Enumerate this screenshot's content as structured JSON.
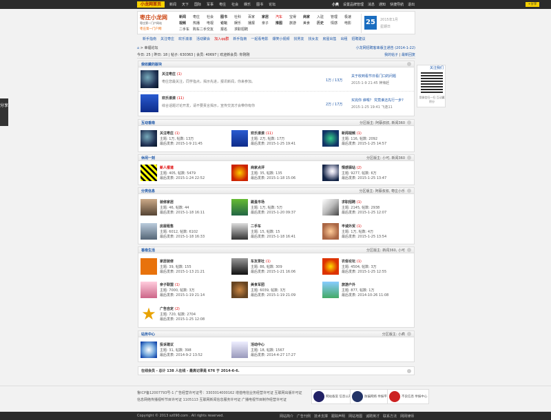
{
  "topbar": {
    "logo": "小龙网首页",
    "nav": [
      "新闻",
      "天下",
      "国际",
      "军事",
      "枣庄",
      "社会",
      "娱乐",
      "图书",
      "论坛"
    ],
    "user": "小奥",
    "links": [
      "设置品牌管理",
      "消息",
      "通知",
      "快捷导航",
      "退出"
    ],
    "share": "+分享"
  },
  "brand": {
    "line1": "枣庄小龙网",
    "line2": "枣庄第一门户网站",
    "line3": "枣庄第一门户网"
  },
  "categories": [
    [
      "新闻",
      "枣庄",
      "社会",
      "图书",
      "社科",
      "百家",
      "家居",
      "汽车",
      "宝得",
      "商家",
      "入驻",
      "管理",
      "极速",
      "二手车",
      "购车二手"
    ],
    [
      "视频",
      "热播",
      "电视",
      "论坛",
      "娱乐",
      "播报",
      "亲子",
      "推图",
      "旅游",
      "美食",
      "历史",
      "情感",
      "电影",
      "交友",
      "报名",
      "求职招聘"
    ]
  ],
  "date": {
    "day": "25",
    "ym": "2015年1月",
    "week": "星期日"
  },
  "subnav": [
    "新手指南",
    "关注枣庄",
    "欢乐滚滚",
    "活动聚会",
    "加入qq群",
    "新手指南",
    "一起看电影",
    "爆笑小视频",
    "找男友",
    "找女友",
    "房屋出售",
    "出租",
    "招聘建议"
  ],
  "crumb": {
    "left": "> 幸福论坛",
    "right": "小龙网招聘客串版主通告 (2014-1-22)"
  },
  "stats": {
    "left": "今日: 25 | 昨日: 18 | 帖子: 630363 | 会员: 40697 | 欢迎新会员: 你刚刚",
    "right_a": "我的帖子",
    "right_b": "最新回复"
  },
  "sections": {
    "favorites": {
      "title": "我收藏的版块",
      "rows": [
        {
          "name": "关注枣庄",
          "count": "(1)",
          "desc": "枣庄您最关注，同学指点，揭示先进，报讯新闻，你来参加。",
          "ratio": "1万 / 13万",
          "last": "关于收到看节日看门口的问题",
          "last_meta": "2015-1-9 21:45 神辣赶"
        },
        {
          "name": "欢乐滚滚",
          "count": "(11)",
          "desc": "综合话题讨论开发，请不要贡言揭示，宣传交流才会带你有你",
          "ratio": "2万 / 17万",
          "last": "买完你 谁喂？ 究竟谁还先行一步?",
          "last_meta": "2015-1-25 19:41 飞逸11"
        }
      ]
    },
    "interact": {
      "title": "互动香南",
      "mods": "分区版主: 阿蔡叔叔, 新闻360"
    },
    "share": {
      "title": "休闲一刻",
      "mods": "分区版主: 小可, 新闻360"
    },
    "info": {
      "title": "分类信息",
      "mods": "分区版主: 阿蔡叔叔, 枣庄小乐"
    },
    "life": {
      "title": "香南生活",
      "mods": "分区版主: 新闻360, 小可"
    },
    "station": {
      "title": "站务中心",
      "mods": "分区版主: 小疯"
    }
  },
  "cells": {
    "interact": [
      {
        "name": "关注枣庄",
        "count": "(1)",
        "l2": "主题: 1万, 帖数: 13万",
        "l3": "最后发表: 2015-1-9 21:45"
      },
      {
        "name": "欢乐滚滚",
        "count": "(11)",
        "l2": "主题: 2万, 帖数: 17万",
        "l3": "最后发表: 2015-1-25 19:41"
      },
      {
        "name": "新闻视频",
        "count": "(1)",
        "l2": "主题: 116, 帖数: 2092",
        "l3": "最后发表: 2015-1-25 14:57"
      }
    ],
    "share": [
      {
        "name": "新人报道",
        "count": "",
        "l2": "主题: 405, 帖数: 5479",
        "l3": "最后发表: 2015-1-24 22:52"
      },
      {
        "name": "商家点评",
        "count": "",
        "l2": "主题: 35, 帖数: 135",
        "l3": "最后发表: 2015-1-18 15:06"
      },
      {
        "name": "情感驿站",
        "count": "(2)",
        "l2": "主题: 9277, 帖数: 6万",
        "l3": "最后发表: 2015-1-25 13:47"
      }
    ],
    "info": [
      {
        "name": "装修家居",
        "count": "",
        "l2": "主题: 46, 帖数: 44",
        "l3": "最后发表: 2015-1-18 16:11"
      },
      {
        "name": "跳蚤市场",
        "count": "",
        "l2": "主题: 1万, 帖数: 5万",
        "l3": "最后发表: 2015-1-20 09:37"
      },
      {
        "name": "求职招聘",
        "count": "(1)",
        "l2": "主题: 2145, 帖数: 2938",
        "l3": "最后发表: 2015-1-25 12:07"
      },
      {
        "name": "房屋租售",
        "count": "",
        "l2": "主题: 6012, 帖数: 6102",
        "l3": "最后发表: 2015-1-18 16:33"
      },
      {
        "name": "二手车",
        "count": "",
        "l2": "主题: 15, 帖数: 15",
        "l3": "最后发表: 2015-1-18 16:41"
      },
      {
        "name": "丰诚外贸",
        "count": "(1)",
        "l2": "主题: 1万, 帖数: 4万",
        "l3": "最后发表: 2015-1-25 13:54"
      }
    ],
    "life": [
      {
        "name": "家居装修",
        "count": "",
        "l2": "主题: 39, 帖数: 155",
        "l3": "最后发表: 2015-1-13 21:21"
      },
      {
        "name": "车友茶社",
        "count": "(1)",
        "l2": "主题: 86, 帖数: 309",
        "l3": "最后发表: 2015-1-21 16:06"
      },
      {
        "name": "农俗论坛",
        "count": "(1)",
        "l2": "主题: 4504, 帖数: 3万",
        "l3": "最后发表: 2015-1-25 12:55"
      },
      {
        "name": "亲子联盟",
        "count": "(1)",
        "l2": "主题: 7000, 帖数: 3万",
        "l3": "最后发表: 2015-1-19 21:14"
      },
      {
        "name": "美食军团",
        "count": "",
        "l2": "主题: 6039, 帖数: 3万",
        "l3": "最后发表: 2015-1-19 21:09"
      },
      {
        "name": "旅游户外",
        "count": "",
        "l2": "主题: 877, 帖数: 1万",
        "l3": "最后发表: 2014-10-26 11:08"
      },
      {
        "name": "广告自定",
        "count": "(2)",
        "l2": "主题: 720, 帖数: 2704",
        "l3": "最后发表: 2015-1-25 12:08"
      }
    ],
    "station": [
      {
        "name": "投诉建议",
        "count": "",
        "l2": "主题: 31, 帖数: 398",
        "l3": "最后发表: 2014-9-2 13:52"
      },
      {
        "name": "活动中心",
        "count": "",
        "l2": "主题: 18, 帖数: 1567",
        "l3": "最后发表: 2014-4-27 17:27"
      }
    ]
  },
  "online": {
    "text": "在线会员 - 总计 138 人在线 - 最高记录是 676 于 2014-6-6.",
    "toggle": ""
  },
  "qr": {
    "head": "关注我们",
    "foot": "用微信扫一扫\n互动赢积分"
  },
  "sideshare": "分享",
  "footer": {
    "lic1": "鲁ICP备12007793号-1  广告经营许可证号：3303014000162  增值电信业务经营许可证  互联网出版许可证",
    "lic2": "信息网络传播视听节目许可证 1105113  互联网新闻信息服务许可证  广播电视节目制作经营许可证",
    "badges": [
      "网站备案 信息公开",
      "防骗网络 举报平台",
      "不良信息 举报中心"
    ]
  },
  "bottombar": {
    "copy": "Copyright © 2013 sz090.com . All rights reserved.",
    "links": [
      "网站简介",
      "广告刊例",
      "技术支撑",
      "跟踪声明",
      "网站地图",
      "诚聘英才",
      "联系方法",
      "网网律师"
    ]
  },
  "colors": {
    "accent": "#1a55a8",
    "brand": "#f6d000",
    "hot": "#dd0000"
  }
}
